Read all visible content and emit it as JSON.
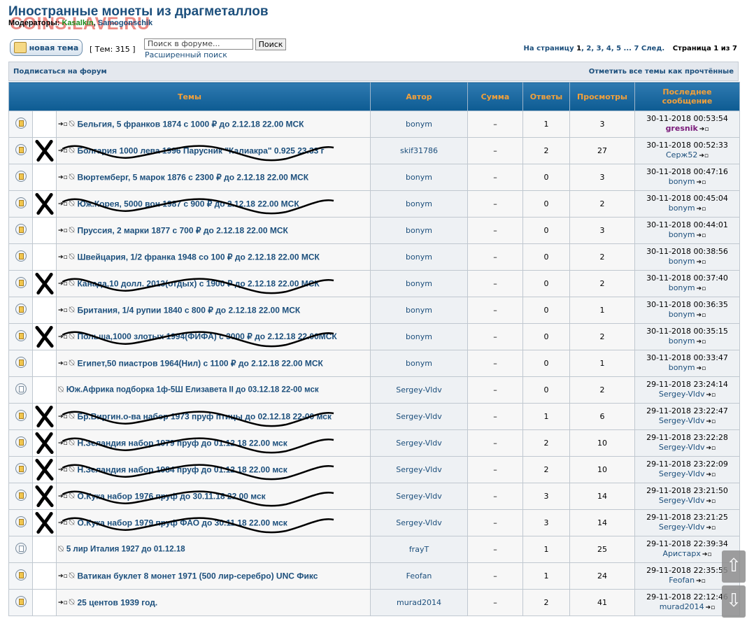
{
  "header": {
    "title": "Иностранные монеты из драгметаллов",
    "watermark": "COINS.LAVE.RU",
    "moderators_label": "Модераторы:",
    "moderator1": "Kasalkin",
    "moderator2": "Samogonschik"
  },
  "toolbar": {
    "new_topic_label": "новая тема",
    "topic_count": "[ Тем: 315 ]",
    "search_placeholder": "Поиск в форуме...",
    "search_button": "Поиск",
    "advanced_search": "Расширенный поиск"
  },
  "pager": {
    "label": "На страницу",
    "pages": [
      "1",
      "2",
      "3",
      "4",
      "5",
      "...",
      "7"
    ],
    "next": "След.",
    "info": "Страница 1 из 7"
  },
  "subbar": {
    "subscribe": "Подписаться на форум",
    "mark_read": "Отметить все темы как прочтённые"
  },
  "columns": {
    "topics": "Темы",
    "author": "Автор",
    "sum": "Сумма",
    "replies": "Ответы",
    "views": "Просмотры",
    "last_post": "Последнее сообщение"
  },
  "rows": [
    {
      "title": "Бельгия, 5 франков 1874 с 1000 ₽ до 2.12.18 22.00 МСК",
      "author": "bonym",
      "sum": "–",
      "replies": "1",
      "views": "3",
      "date": "30-11-2018 00:53:54",
      "last_user": "gresnik"
    },
    {
      "title": "Болгария 1000 лева 1996 Парусник \"Калиакра\" 0.925 23.33 г",
      "author": "skif31786",
      "sum": "–",
      "replies": "2",
      "views": "27",
      "date": "30-11-2018 00:52:33",
      "last_user": "Серж52"
    },
    {
      "title": "Вюртемберг, 5 марок 1876 с 2300 ₽ до 2.12.18 22.00 МСК",
      "author": "bonym",
      "sum": "–",
      "replies": "0",
      "views": "3",
      "date": "30-11-2018 00:47:16",
      "last_user": "bonym"
    },
    {
      "title": "Юж.Корея, 5000 вон 1987 с 900 ₽ до 2.12.18 22.00 МСК",
      "author": "bonym",
      "sum": "–",
      "replies": "0",
      "views": "2",
      "date": "30-11-2018 00:45:04",
      "last_user": "bonym"
    },
    {
      "title": "Пруссия, 2 марки 1877 с 700 ₽ до 2.12.18 22.00 МСК",
      "author": "bonym",
      "sum": "–",
      "replies": "0",
      "views": "3",
      "date": "30-11-2018 00:44:01",
      "last_user": "bonym"
    },
    {
      "title": "Швейцария, 1/2 франка 1948 со 100 ₽ до 2.12.18 22.00 МСК",
      "author": "bonym",
      "sum": "–",
      "replies": "0",
      "views": "2",
      "date": "30-11-2018 00:38:56",
      "last_user": "bonym"
    },
    {
      "title": "Канада,10 долл. 2013(отдых) с 1900 ₽ до 2.12.18 22.00 МСК",
      "author": "bonym",
      "sum": "–",
      "replies": "0",
      "views": "2",
      "date": "30-11-2018 00:37:40",
      "last_user": "bonym"
    },
    {
      "title": "Британия, 1/4 рупии 1840 с 800 ₽ до 2.12.18 22.00 МСК",
      "author": "bonym",
      "sum": "–",
      "replies": "0",
      "views": "1",
      "date": "30-11-2018 00:36:35",
      "last_user": "bonym"
    },
    {
      "title": "Польша,1000 злотых 1994(ФИФА) с 3000 ₽ до 2.12.18 22.00МСК",
      "author": "bonym",
      "sum": "–",
      "replies": "0",
      "views": "2",
      "date": "30-11-2018 00:35:15",
      "last_user": "bonym"
    },
    {
      "title": "Египет,50 пиастров 1964(Нил) с 1100 ₽ до 2.12.18 22.00 МСК",
      "author": "bonym",
      "sum": "–",
      "replies": "0",
      "views": "1",
      "date": "30-11-2018 00:33:47",
      "last_user": "bonym"
    },
    {
      "title": "Юж.Африка подборка 1ф-5Ш Елизавета II до 03.12.18 22-00 мск",
      "author": "Sergey-Vldv",
      "sum": "–",
      "replies": "0",
      "views": "2",
      "date": "29-11-2018 23:24:14",
      "last_user": "Sergey-Vldv"
    },
    {
      "title": "Бр.Виргин.о-ва набор 1973 пруф птицы до 02.12.18 22-00 мск",
      "author": "Sergey-Vldv",
      "sum": "–",
      "replies": "1",
      "views": "6",
      "date": "29-11-2018 23:22:47",
      "last_user": "Sergey-Vldv"
    },
    {
      "title": "Н.Зеландия набор 1979 пруф до 01.12.18 22.00 мск",
      "author": "Sergey-Vldv",
      "sum": "–",
      "replies": "2",
      "views": "10",
      "date": "29-11-2018 23:22:28",
      "last_user": "Sergey-Vldv"
    },
    {
      "title": "Н.Зеландия набор 1984 пруф до 01.12.18 22.00 мск",
      "author": "Sergey-Vldv",
      "sum": "–",
      "replies": "2",
      "views": "10",
      "date": "29-11-2018 23:22:09",
      "last_user": "Sergey-Vldv"
    },
    {
      "title": "О.Кука набор 1976 пруф до 30.11.18 22.00 мск",
      "author": "Sergey-Vldv",
      "sum": "–",
      "replies": "3",
      "views": "14",
      "date": "29-11-2018 23:21:50",
      "last_user": "Sergey-Vldv"
    },
    {
      "title": "О.Кука набор 1979 пруф ФАО до 30.11.18 22.00 мск",
      "author": "Sergey-Vldv",
      "sum": "–",
      "replies": "3",
      "views": "14",
      "date": "29-11-2018 23:21:25",
      "last_user": "Sergey-Vldv"
    },
    {
      "title": "5 лир Италия 1927 до 01.12.18",
      "author": "frayT",
      "sum": "–",
      "replies": "1",
      "views": "25",
      "date": "29-11-2018 22:39:34",
      "last_user": "Аристарх"
    },
    {
      "title": "Ватикан буклет 8 монет 1971 (500 лир-серебро) UNC Фикс",
      "author": "Feofan",
      "sum": "–",
      "replies": "1",
      "views": "24",
      "date": "29-11-2018 22:35:55",
      "last_user": "Feofan"
    },
    {
      "title": "25 центов 1939 год.",
      "author": "murad2014",
      "sum": "–",
      "replies": "2",
      "views": "41",
      "date": "29-11-2018 22:12:46",
      "last_user": "murad2014"
    }
  ]
}
